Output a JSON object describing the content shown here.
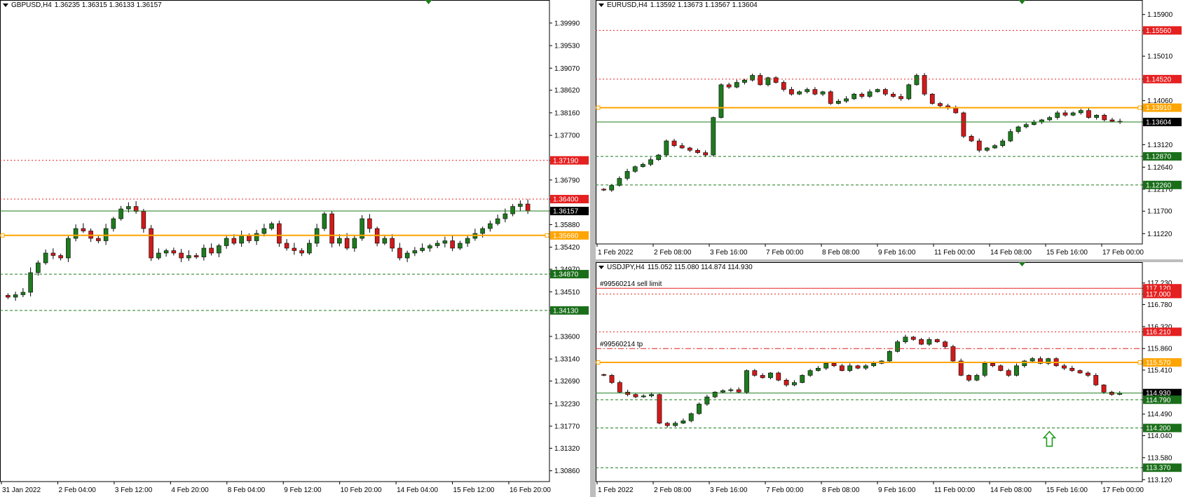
{
  "colors": {
    "bull": "#1e7b1e",
    "bear": "#d11a1a",
    "orange": "#ffa500",
    "red_level": "#e52020",
    "green_level": "#1e7b1e",
    "tag_red": "#e52020",
    "tag_green": "#1a6e1a",
    "tag_orange": "#ffa500",
    "tag_black": "#000000",
    "scale_text": "#000000"
  },
  "chart_data": [
    {
      "id": "gbp",
      "type": "candlestick",
      "title": "GBPUSD,H4",
      "ohlc": "1.36235 1.36315 1.36133 1.36157",
      "ylim": [
        1.3064,
        1.4026
      ],
      "decimals": 5,
      "scale_ticks": [
        "1.39990",
        "1.39530",
        "1.39070",
        "1.38620",
        "1.38160",
        "1.37700",
        "1.37190",
        "1.36790",
        "1.36400",
        "1.36157",
        "1.35880",
        "1.35420",
        "1.34970",
        "1.34870",
        "1.34510",
        "1.34130",
        "1.33600",
        "1.33140",
        "1.32690",
        "1.32230",
        "1.31770",
        "1.31320",
        "1.30860"
      ],
      "x_labels": [
        "31 Jan 2022",
        "2 Feb 04:00",
        "3 Feb 12:00",
        "4 Feb 20:00",
        "8 Feb 04:00",
        "9 Feb 12:00",
        "10 Feb 20:00",
        "14 Feb 04:00",
        "15 Feb 12:00",
        "16 Feb 20:00"
      ],
      "levels": [
        {
          "price": 1.3719,
          "color": "red",
          "style": "dot",
          "tag": "1.37190"
        },
        {
          "price": 1.364,
          "color": "red",
          "style": "dot",
          "tag": "1.36400"
        },
        {
          "price": 1.36157,
          "color": "green",
          "style": "solid",
          "tag": "1.36157",
          "tag_color": "black"
        },
        {
          "price": 1.3566,
          "color": "orange",
          "style": "thick",
          "tag": "1.35660"
        },
        {
          "price": 1.3487,
          "color": "green",
          "style": "dash",
          "tag": "1.34870"
        },
        {
          "price": 1.3413,
          "color": "green",
          "style": "dash",
          "tag": "1.34130"
        }
      ],
      "closes": [
        1.344,
        1.3445,
        1.345,
        1.349,
        1.351,
        1.353,
        1.3525,
        1.352,
        1.356,
        1.358,
        1.3575,
        1.356,
        1.3555,
        1.358,
        1.36,
        1.362,
        1.3625,
        1.3615,
        1.358,
        1.352,
        1.353,
        1.3535,
        1.353,
        1.352,
        1.3525,
        1.3522,
        1.354,
        1.353,
        1.3545,
        1.356,
        1.355,
        1.3565,
        1.3555,
        1.357,
        1.358,
        1.359,
        1.355,
        1.354,
        1.3535,
        1.353,
        1.355,
        1.358,
        1.361,
        1.355,
        1.356,
        1.354,
        1.356,
        1.36,
        1.358,
        1.355,
        1.356,
        1.354,
        1.352,
        1.353,
        1.3535,
        1.354,
        1.3545,
        1.355,
        1.3555,
        1.354,
        1.355,
        1.356,
        1.357,
        1.358,
        1.359,
        1.36,
        1.361,
        1.3625,
        1.363,
        1.3616
      ]
    },
    {
      "id": "eur",
      "type": "candlestick",
      "title": "EURUSD,H4",
      "ohlc": "1.13592 1.13673 1.13567 1.13604",
      "ylim": [
        1.11,
        1.16
      ],
      "decimals": 5,
      "scale_ticks": [
        "1.15900",
        "1.15560",
        "1.15010",
        "1.14520",
        "1.14060",
        "1.13910",
        "1.13604",
        "1.13120",
        "1.12870",
        "1.12640",
        "1.12260",
        "1.12170",
        "1.11700",
        "1.11220"
      ],
      "x_labels": [
        "1 Feb 2022",
        "2 Feb 08:00",
        "3 Feb 16:00",
        "7 Feb 00:00",
        "8 Feb 08:00",
        "9 Feb 16:00",
        "11 Feb 00:00",
        "14 Feb 08:00",
        "15 Feb 16:00",
        "17 Feb 00:00"
      ],
      "levels": [
        {
          "price": 1.1556,
          "color": "red",
          "style": "dot",
          "tag": "1.15560"
        },
        {
          "price": 1.1452,
          "color": "red",
          "style": "dot",
          "tag": "1.14520"
        },
        {
          "price": 1.1391,
          "color": "orange",
          "style": "thick",
          "tag": "1.13910"
        },
        {
          "price": 1.13604,
          "color": "green",
          "style": "solid",
          "tag": "1.13604",
          "tag_color": "black"
        },
        {
          "price": 1.1287,
          "color": "green",
          "style": "dash",
          "tag": "1.12870"
        },
        {
          "price": 1.1226,
          "color": "green",
          "style": "dash",
          "tag": "1.12260"
        }
      ],
      "closes": [
        1.1215,
        1.1225,
        1.124,
        1.1255,
        1.1265,
        1.127,
        1.128,
        1.129,
        1.132,
        1.131,
        1.1305,
        1.13,
        1.1295,
        1.129,
        1.137,
        1.144,
        1.1435,
        1.1445,
        1.145,
        1.146,
        1.144,
        1.1455,
        1.1445,
        1.143,
        1.142,
        1.1425,
        1.143,
        1.142,
        1.1425,
        1.14,
        1.1405,
        1.141,
        1.142,
        1.1415,
        1.1425,
        1.143,
        1.142,
        1.1415,
        1.141,
        1.144,
        1.146,
        1.142,
        1.14,
        1.1395,
        1.139,
        1.138,
        1.133,
        1.132,
        1.13,
        1.1305,
        1.131,
        1.132,
        1.134,
        1.135,
        1.1355,
        1.136,
        1.1365,
        1.137,
        1.138,
        1.1375,
        1.138,
        1.1385,
        1.137,
        1.1375,
        1.1365,
        1.1362,
        1.136
      ]
    },
    {
      "id": "jpy",
      "type": "candlestick",
      "title": "USDJPY,H4",
      "ohlc": "115.052 115.080 114.874 114.930",
      "ylim": [
        113.08,
        117.46
      ],
      "decimals": 3,
      "scale_ticks": [
        "117.230",
        "117.120",
        "117.000",
        "116.780",
        "116.320",
        "116.210",
        "115.860",
        "115.570",
        "115.410",
        "114.930",
        "114.790",
        "114.490",
        "114.200",
        "114.040",
        "113.580",
        "113.370",
        "113.120"
      ],
      "x_labels": [
        "1 Feb 2022",
        "2 Feb 08:00",
        "3 Feb 16:00",
        "7 Feb 00:00",
        "8 Feb 08:00",
        "9 Feb 16:00",
        "11 Feb 00:00",
        "14 Feb 08:00",
        "15 Feb 16:00",
        "17 Feb 00:00"
      ],
      "levels": [
        {
          "price": 117.12,
          "color": "red",
          "style": "solid",
          "tag": "117.120",
          "label": "#99560214 sell limit"
        },
        {
          "price": 117.0,
          "color": "red",
          "style": "dot",
          "tag": "117.000"
        },
        {
          "price": 116.21,
          "color": "red",
          "style": "dot",
          "tag": "116.210"
        },
        {
          "price": 115.86,
          "color": "red",
          "style": "dashdot",
          "tag": "",
          "label": "#99560214 tp"
        },
        {
          "price": 115.57,
          "color": "orange",
          "style": "thick",
          "tag": "115.570"
        },
        {
          "price": 114.93,
          "color": "green",
          "style": "solid",
          "tag": "114.930",
          "tag_color": "black"
        },
        {
          "price": 114.79,
          "color": "green",
          "style": "dash",
          "tag": "114.790"
        },
        {
          "price": 114.2,
          "color": "green",
          "style": "dash",
          "tag": "114.200"
        },
        {
          "price": 113.37,
          "color": "green",
          "style": "dash",
          "tag": "113.370"
        }
      ],
      "closes": [
        115.3,
        115.15,
        114.95,
        114.9,
        114.85,
        114.87,
        114.9,
        114.3,
        114.25,
        114.3,
        114.35,
        114.5,
        114.7,
        114.85,
        114.95,
        114.98,
        115.0,
        114.95,
        115.4,
        115.3,
        115.25,
        115.35,
        115.2,
        115.1,
        115.15,
        115.3,
        115.4,
        115.45,
        115.55,
        115.5,
        115.4,
        115.5,
        115.45,
        115.5,
        115.55,
        115.6,
        115.8,
        116.0,
        116.1,
        116.05,
        115.95,
        116.05,
        116.0,
        115.9,
        115.6,
        115.3,
        115.2,
        115.3,
        115.55,
        115.5,
        115.4,
        115.3,
        115.5,
        115.6,
        115.65,
        115.55,
        115.65,
        115.5,
        115.45,
        115.4,
        115.35,
        115.3,
        115.1,
        114.95,
        114.9,
        114.93
      ]
    }
  ],
  "trade_arrow": {
    "direction": "up",
    "price": 113.95
  }
}
